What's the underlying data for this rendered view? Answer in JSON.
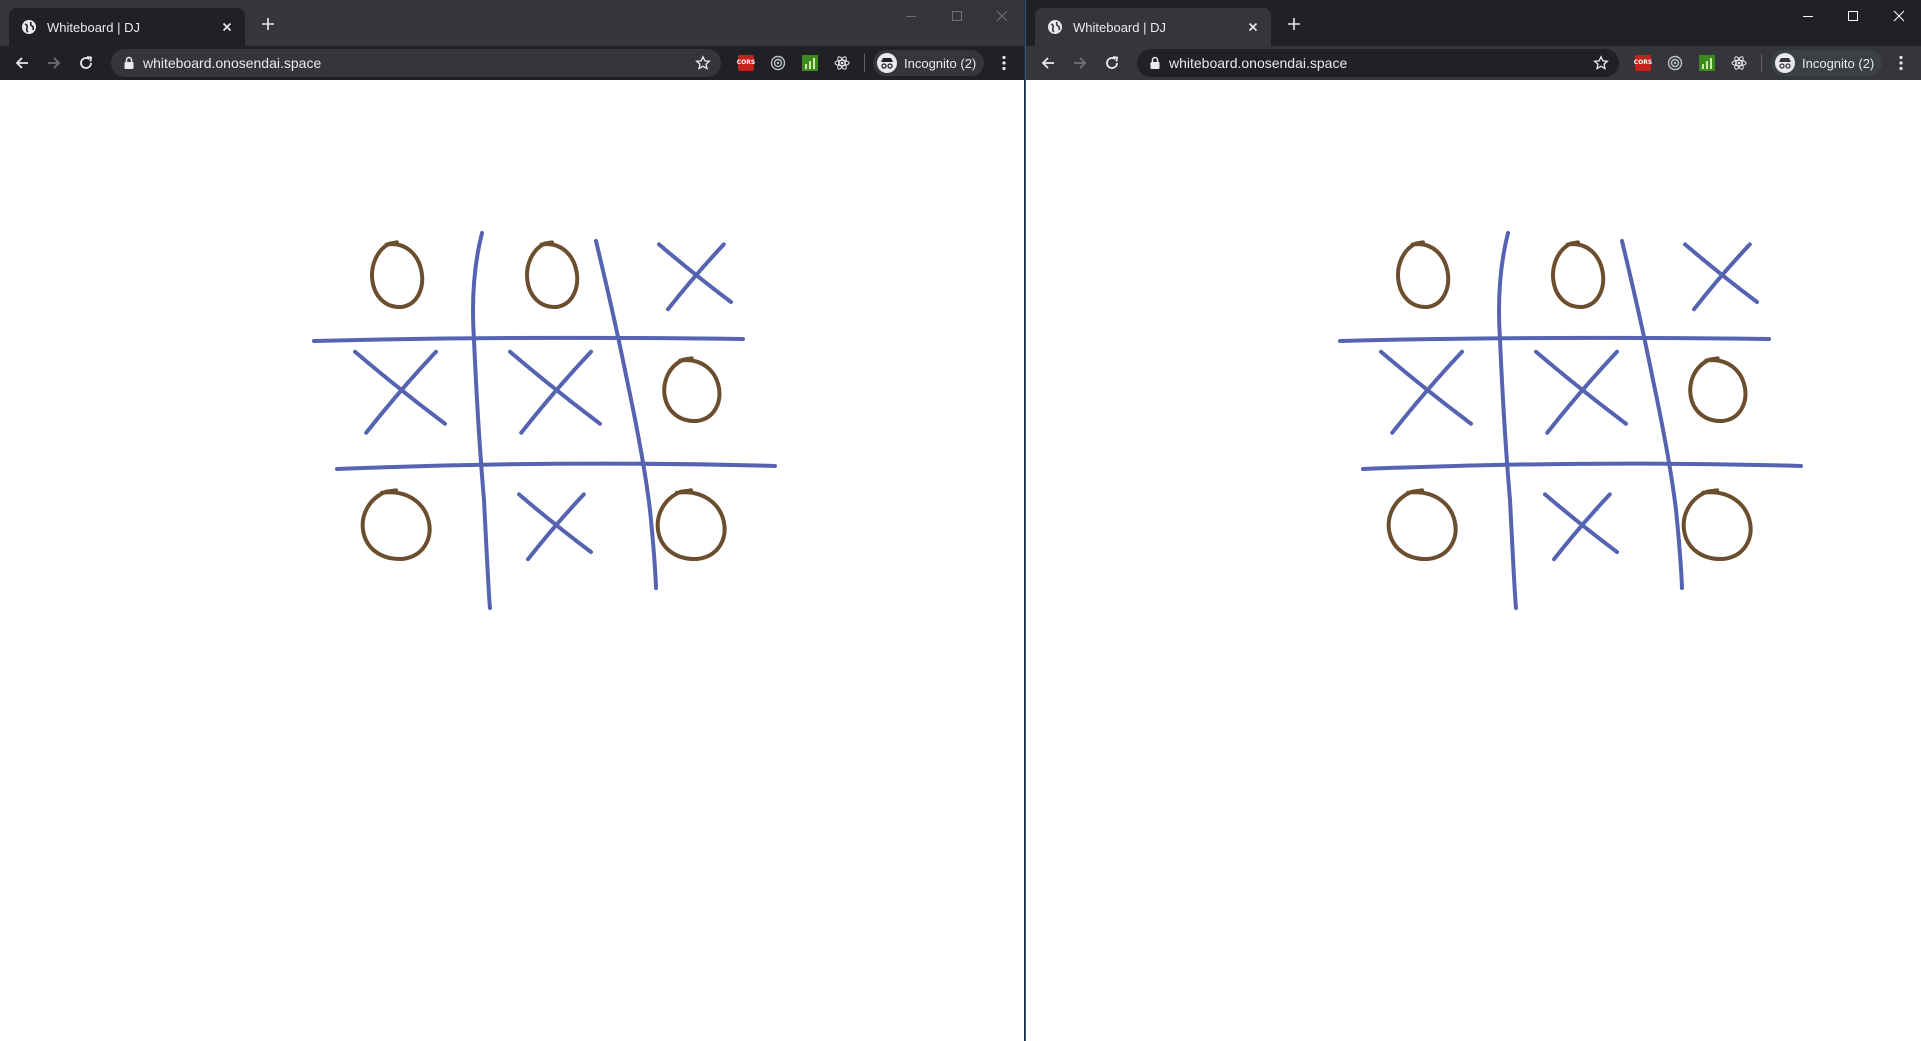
{
  "windows": [
    {
      "id": "left",
      "tab": {
        "title": "Whiteboard | DJ"
      },
      "address": {
        "url": "whiteboard.onosendai.space"
      },
      "profile": {
        "label": "Incognito (2)"
      },
      "extensions": [
        {
          "name": "cors-icon",
          "label": "CORS"
        },
        {
          "name": "target-icon"
        },
        {
          "name": "chart-icon"
        },
        {
          "name": "react-icon"
        }
      ]
    },
    {
      "id": "right",
      "tab": {
        "title": "Whiteboard | DJ"
      },
      "address": {
        "url": "whiteboard.onosendai.space"
      },
      "profile": {
        "label": "Incognito (2)"
      },
      "extensions": [
        {
          "name": "cors-icon",
          "label": "CORS"
        },
        {
          "name": "target-icon"
        },
        {
          "name": "chart-icon"
        },
        {
          "name": "react-icon"
        }
      ]
    }
  ],
  "board": {
    "stroke_colors": {
      "grid": "#5563b0",
      "x_mark": "#5563b0",
      "o_mark": "#6b4e2e"
    },
    "cells": [
      [
        "O",
        "O",
        "X"
      ],
      [
        "X",
        "X",
        "O"
      ],
      [
        "O",
        "X",
        "O"
      ]
    ]
  },
  "theme": {
    "titlebar_dark": "#202124",
    "toolbar_gray": "#35363a",
    "text": "#e8eaed",
    "icon_dim": "#9aa0a6"
  }
}
